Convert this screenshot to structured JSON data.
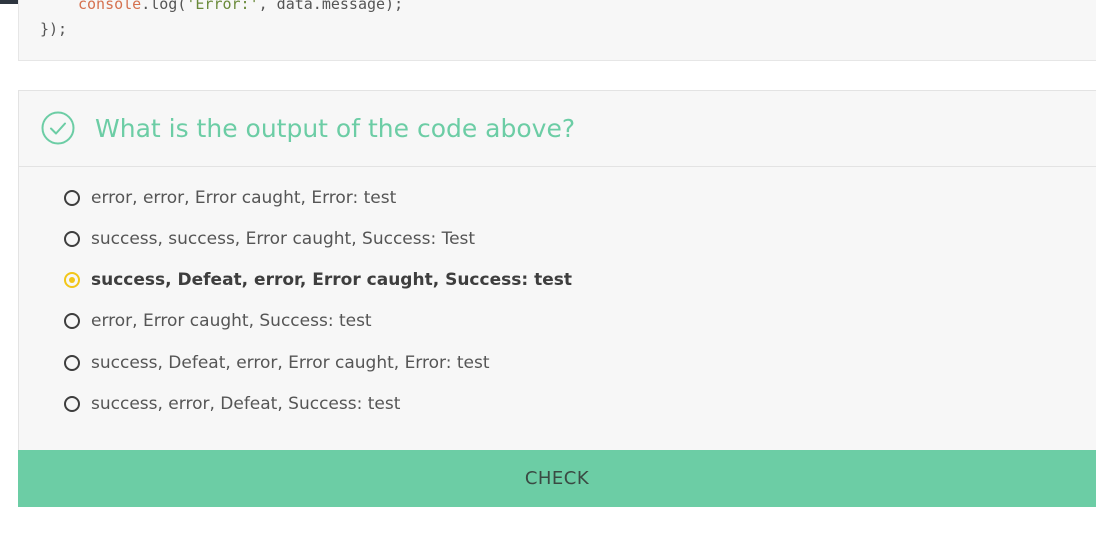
{
  "code": {
    "line1": {
      "func": "console",
      "mid": ".log(",
      "str": "'Error:'",
      "rest": ", data.message);"
    },
    "line2": "});"
  },
  "quiz": {
    "question": "What is the output of the code above?",
    "options": [
      {
        "label": "error, error, Error caught, Error: test",
        "selected": false
      },
      {
        "label": "success, success, Error caught, Success: Test",
        "selected": false
      },
      {
        "label": "success, Defeat, error, Error caught, Success: test",
        "selected": true
      },
      {
        "label": "error, Error caught, Success: test",
        "selected": false
      },
      {
        "label": "success, Defeat, error, Error caught, Error: test",
        "selected": false
      },
      {
        "label": "success, error, Defeat, Success: test",
        "selected": false
      }
    ],
    "check_label": "CHECK"
  },
  "colors": {
    "accent": "#6ccda5",
    "selected": "#f2c619",
    "topbar": "#2e3640"
  },
  "icons": {
    "header": "check-circle-icon"
  }
}
